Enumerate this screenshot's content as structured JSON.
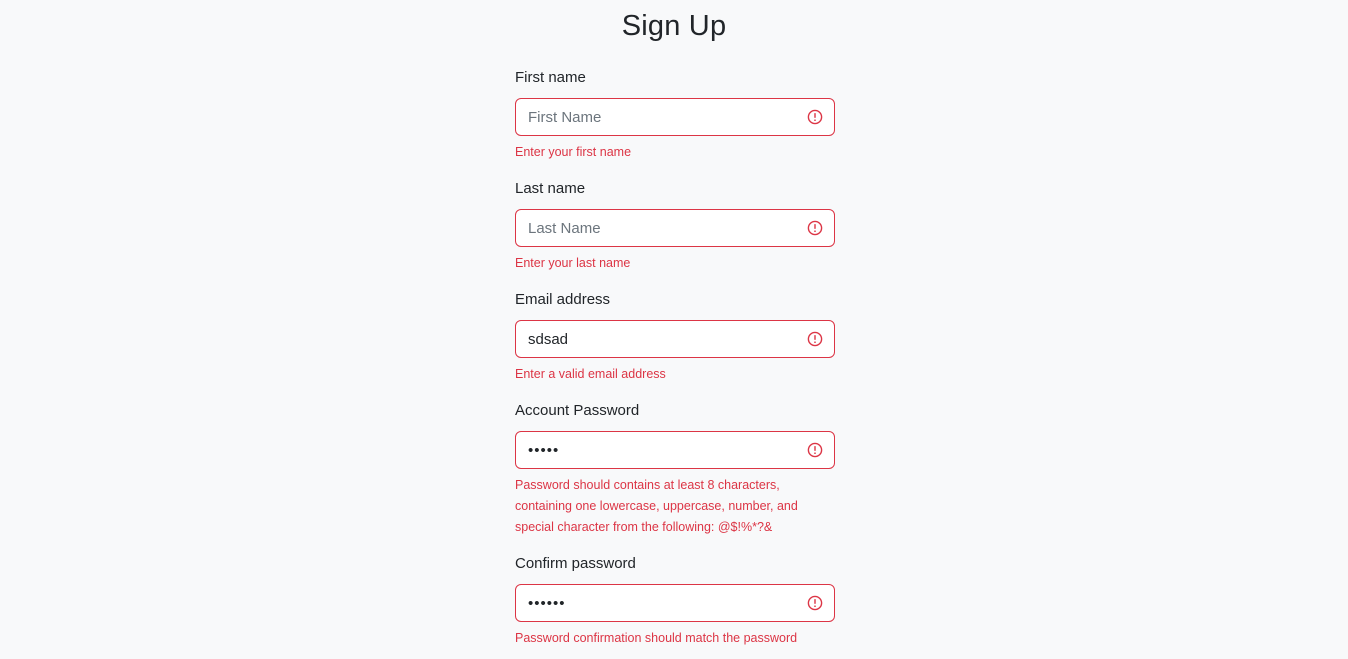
{
  "page": {
    "title": "Sign Up"
  },
  "form": {
    "first_name": {
      "label": "First name",
      "placeholder": "First Name",
      "value": "",
      "error": "Enter your first name"
    },
    "last_name": {
      "label": "Last name",
      "placeholder": "Last Name",
      "value": "",
      "error": "Enter your last name"
    },
    "email": {
      "label": "Email address",
      "placeholder": "",
      "value": "sdsad",
      "error": "Enter a valid email address"
    },
    "password": {
      "label": "Account Password",
      "value": "•••••",
      "error": "Password should contains at least 8 characters, containing one lowercase, uppercase, number, and special character from the following: @$!%*?&"
    },
    "confirm_password": {
      "label": "Confirm password",
      "value": "••••••",
      "error": "Password confirmation should match the password"
    }
  },
  "icons": {
    "error": "exclamation-circle-icon"
  },
  "colors": {
    "background": "#f8f9fa",
    "error": "#dc3545",
    "text": "#212529",
    "placeholder": "#6c757d"
  }
}
